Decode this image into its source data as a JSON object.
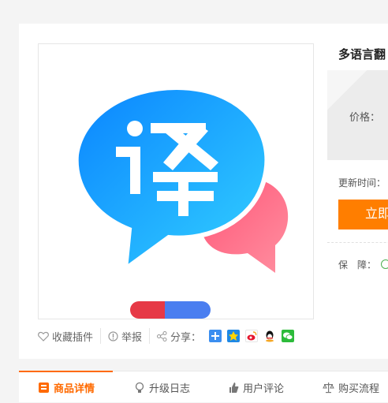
{
  "product": {
    "title": "多语言翻",
    "price_label": "价格：",
    "update_label": "更新时间：",
    "buy_button": "立即",
    "guarantee_label": "保　障："
  },
  "actions": {
    "favorite": "收藏插件",
    "report": "举报",
    "share": "分享："
  },
  "share_icons": [
    "plus-icon",
    "qzone-icon",
    "weibo-icon",
    "qq-icon",
    "wechat-icon"
  ],
  "tabs": [
    {
      "label": "商品详情",
      "icon": "detail-icon",
      "active": true
    },
    {
      "label": "升级日志",
      "icon": "bulb-icon",
      "active": false
    },
    {
      "label": "用户评论",
      "icon": "thumb-icon",
      "active": false
    },
    {
      "label": "购买流程",
      "icon": "scale-icon",
      "active": false
    }
  ],
  "colors": {
    "accent": "#ff6a00",
    "buy_button": "#ff7e00",
    "logo_blue": "#1aa3ff",
    "logo_pink": "#ff6b81"
  }
}
